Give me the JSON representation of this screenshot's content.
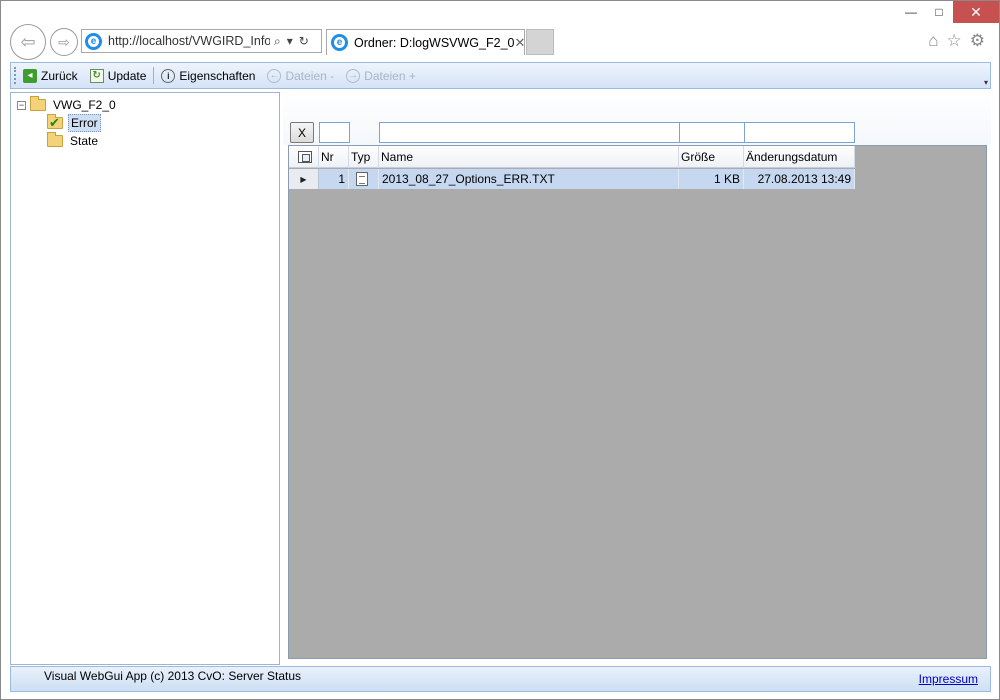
{
  "browser": {
    "address": "http://localhost/VWGIRD_Info/",
    "tab_title": "Ordner: D:logWSVWG_F2_0",
    "tab_close": "✕",
    "window_controls": {
      "minimize": "—",
      "maximize": "□",
      "close": "✕"
    }
  },
  "toolbar": {
    "back_label": "Zurück",
    "update_label": "Update",
    "properties_label": "Eigenschaften",
    "files_prev_label": "Dateien -",
    "files_next_label": "Dateien +"
  },
  "tree": {
    "root": {
      "label": "VWG_F2_0",
      "expander": "−"
    },
    "children": [
      {
        "label": "Error",
        "selected": true
      },
      {
        "label": "State",
        "selected": false
      }
    ]
  },
  "filter": {
    "clear_label": "X"
  },
  "grid": {
    "columns": [
      "Nr",
      "Typ",
      "Name",
      "Größe",
      "Änderungsdatum"
    ],
    "rows": [
      {
        "nr": "1",
        "name": "2013_08_27_Options_ERR.TXT",
        "size": "1 KB",
        "modified": "27.08.2013 13:49"
      }
    ]
  },
  "status": {
    "text": "Visual WebGui App (c) 2013 CvO: Server Status",
    "link": "Impressum"
  },
  "colors": {
    "toolbar_gradient_top": "#eef4fc",
    "toolbar_gradient_bottom": "#d4e3f7",
    "grid_background": "#ababab",
    "selected_row": "#c6d8ef",
    "close_button": "#c75050",
    "link": "#0000cc"
  }
}
